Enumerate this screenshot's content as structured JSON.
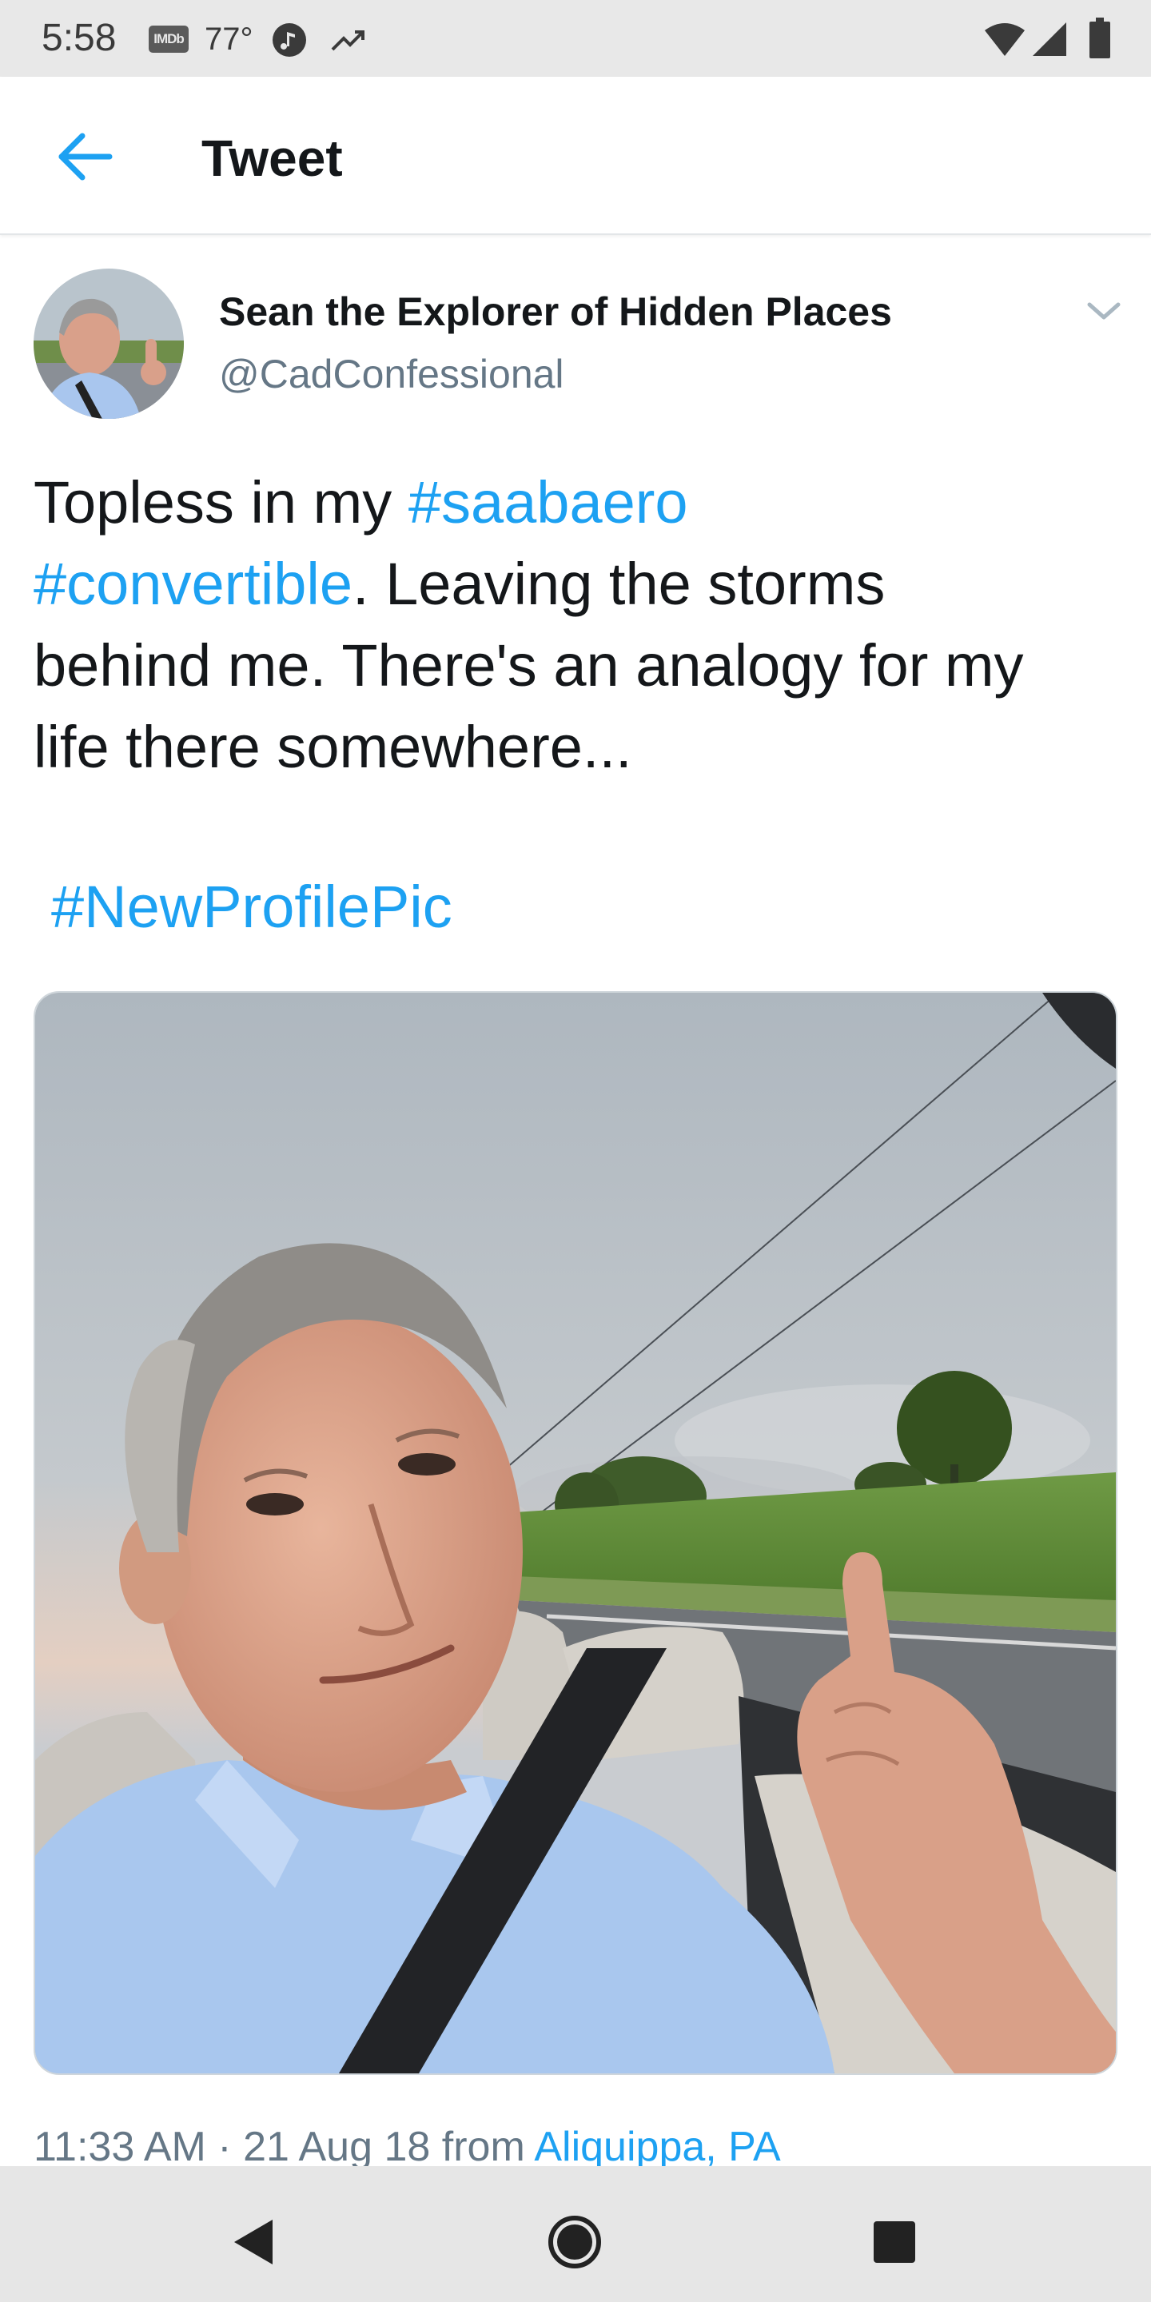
{
  "status_bar": {
    "time": "5:58",
    "imdb_badge": "IMDb",
    "temperature": "77°",
    "icons": [
      "imdb-icon",
      "music-note-icon",
      "trending-icon",
      "wifi-icon",
      "cell-signal-icon",
      "battery-icon"
    ]
  },
  "header": {
    "title": "Tweet",
    "back_icon": "arrow-left-icon"
  },
  "tweet": {
    "author_name": "Sean the Explorer of Hidden Places",
    "author_handle": "@CadConfessional",
    "text": {
      "part1": "Topless in my ",
      "hashtag1": "#saabaero",
      "hashtag2": "#convertible",
      "part2": ". Leaving the storms",
      "line3": "behind me. There's an analogy for my",
      "line4": "life there somewhere...",
      "hashtag3": "#NewProfilePic"
    },
    "meta": {
      "time": "11:33 AM",
      "separator": " · ",
      "date": "21 Aug 18",
      "from_label": "from",
      "location": "Aliquippa, PA"
    }
  },
  "nav": {
    "icons": [
      "nav-back-icon",
      "nav-home-icon",
      "nav-recents-icon"
    ]
  },
  "colors": {
    "accent": "#1da1f2",
    "text": "#14171a",
    "secondary_text": "#657786",
    "status_bar": "#e8e8e8",
    "nav_bar": "#e6e6e6"
  }
}
